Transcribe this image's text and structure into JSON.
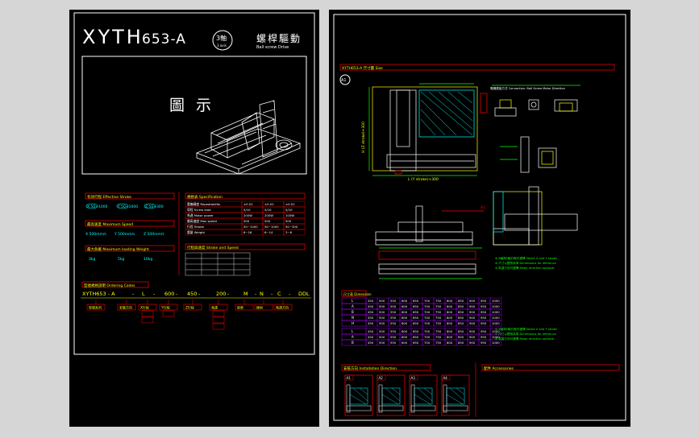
{
  "title": {
    "model": "XYTH",
    "suffix": "653-A",
    "axis_badge": "3軸",
    "axis_badge_sub": "3 axis",
    "name_cn": "螺桿驅動",
    "name_en": "Ball screw Drive"
  },
  "illustration": {
    "label": "圖 示"
  },
  "left_sections": {
    "stroke_header": "有效行程 Effective Stroke",
    "strokes": [
      "X 50~1000",
      "Y 50~1000",
      "Z 50~300"
    ],
    "speed_header": "最高速度 Maximum Speed",
    "speeds": [
      "X 500mm/s",
      "Y 500mm/s",
      "Z 500mm/s"
    ],
    "load_header": "最大負載 Maximum loading Weight",
    "loads": [
      "3kg",
      "5kg",
      "10kg"
    ],
    "spec_header": "規格表 Specification",
    "spec_rows": [
      [
        "重複精度 Repeatability",
        "±0.02",
        "±0.02",
        "±0.02"
      ],
      [
        "導程 Screw lead",
        "5/10",
        "5/10",
        "5/10"
      ],
      [
        "馬達 Motor power",
        "200W",
        "200W",
        "100W"
      ],
      [
        "最高速度 Max speed",
        "500",
        "500",
        "500"
      ],
      [
        "行程 Stroke",
        "50~1000",
        "50~1000",
        "50~300"
      ],
      [
        "重量 Weight",
        "8~16",
        "6~14",
        "3~6"
      ]
    ],
    "stroke_speed_header": "行程與速度 Stroke and Speed",
    "ordering_header": "型號規格說明 Ordering Codes",
    "ordering_code": [
      "XYTH653 - A",
      "L",
      "600",
      "450",
      "200",
      "M",
      "N",
      "C",
      "DDL"
    ],
    "ordering_boxes": [
      "型號系列",
      "安裝方向",
      "X行程",
      "Y行程",
      "Z行程",
      "馬達",
      "剎車",
      "線材",
      "馬達方向"
    ]
  },
  "right_sections": {
    "header": "XYTH653-A 尺寸圖 Size",
    "view_label": "A1",
    "stroke_note": "L (Y stroke)+300",
    "height_note": "H (Z stroke)+300",
    "a_label": "A1",
    "connection_header": "電纜連接方式 Connection: Ball Screw Motor Direction",
    "dim_table_header": "尺寸表 Dimension",
    "dim_rows": [
      "L",
      "A",
      "B",
      "N",
      "H"
    ],
    "dim_values": [
      "450",
      "500",
      "550",
      "600",
      "650",
      "700",
      "750",
      "800",
      "850",
      "900",
      "950",
      "1000"
    ],
    "notes": [
      "※ X軸與Y軸行程可選擇 Select X and Y stroke",
      "※ 尺寸以實物為準 Dimensions for reference",
      "※ 馬達方向可選擇 Motor direction optional"
    ],
    "install_header": "安裝方向 Installation Direction",
    "install_labels": [
      "A1",
      "A2",
      "A3",
      "A4"
    ],
    "accessory_header": "配件 Accessories"
  }
}
